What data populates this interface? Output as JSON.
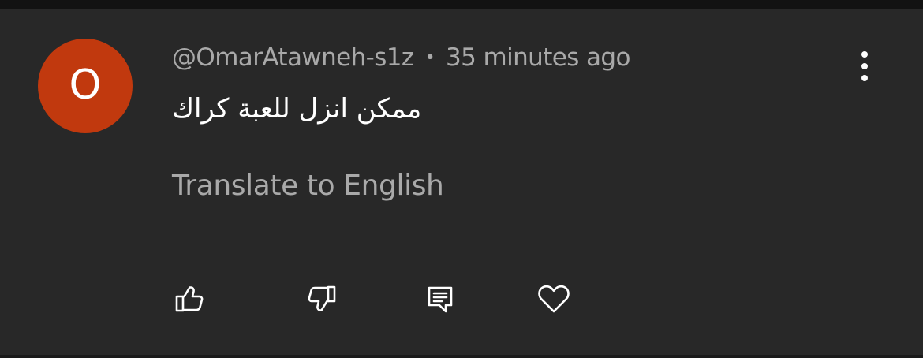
{
  "comment": {
    "avatar_letter": "O",
    "avatar_color": "#c1390e",
    "author": "@OmarAtawneh-s1z",
    "separator": "•",
    "timestamp": "35 minutes ago",
    "text": "ممكن انزل للعبة كراك",
    "translate_label": "Translate to English"
  },
  "actions": [
    {
      "icon": "thumbs-up-icon"
    },
    {
      "icon": "thumbs-down-icon"
    },
    {
      "icon": "reply-icon"
    },
    {
      "icon": "heart-icon"
    }
  ],
  "menu": {
    "icon": "more-vert-icon"
  },
  "colors": {
    "background": "#282828",
    "primary_text": "#ffffff",
    "secondary_text": "#a9a9a9"
  }
}
